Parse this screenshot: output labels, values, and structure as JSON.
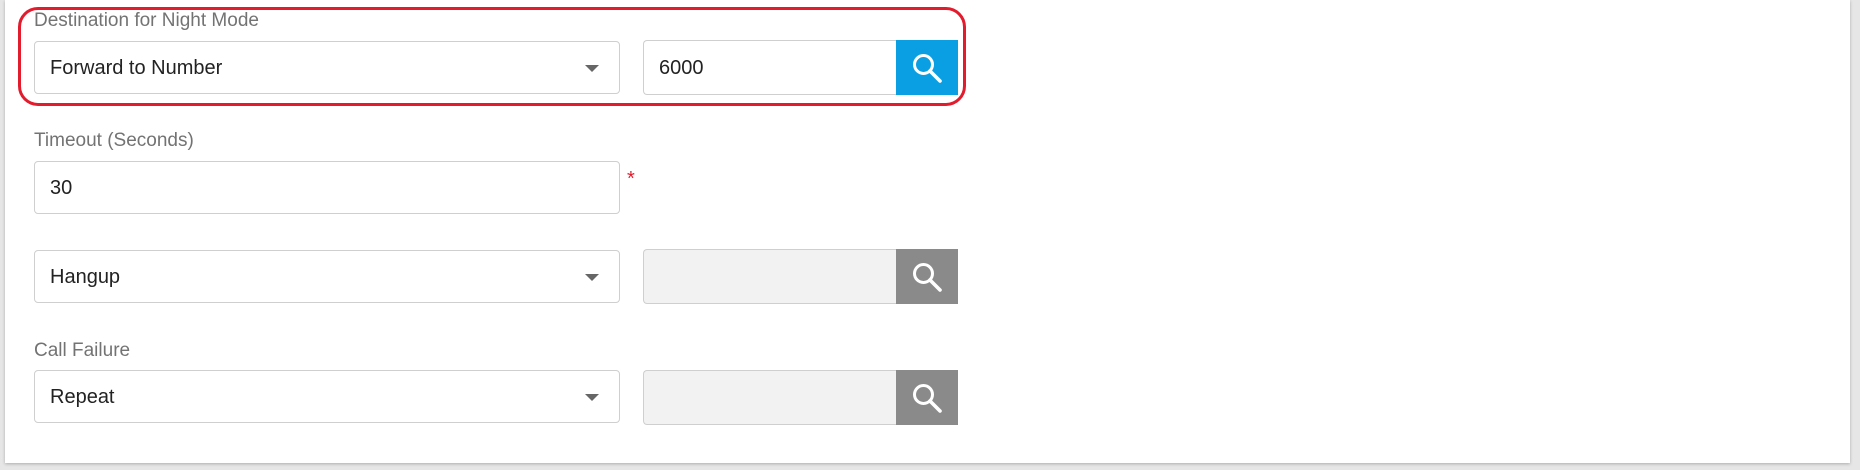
{
  "night_mode": {
    "label": "Destination for Night Mode",
    "type_value": "Forward to Number",
    "number_value": "6000"
  },
  "timeout": {
    "label": "Timeout (Seconds)",
    "value": "30",
    "required_mark": "*"
  },
  "timeout_action": {
    "type_value": "Hangup",
    "target_value": ""
  },
  "call_failure": {
    "label": "Call Failure",
    "type_value": "Repeat",
    "target_value": ""
  },
  "colors": {
    "search_button_active": "#0a9fe3",
    "search_button_disabled": "#8a8a8a",
    "highlight_border": "#e21b2d",
    "required_star": "#e21b2d"
  },
  "icons": {
    "search": "search-icon",
    "dropdown": "caret-down-icon"
  }
}
